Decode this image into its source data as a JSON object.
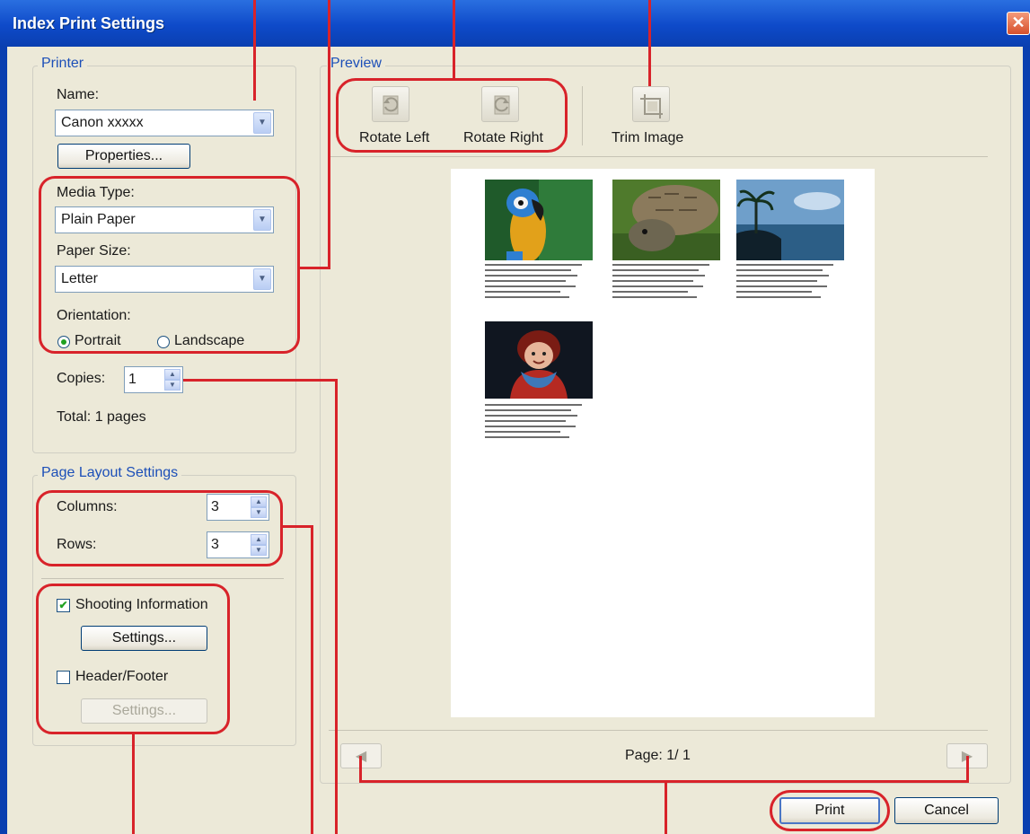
{
  "window": {
    "title": "Index Print Settings",
    "close_glyph": "✕"
  },
  "printer": {
    "legend": "Printer",
    "name_label": "Name:",
    "name_value": "Canon xxxxx",
    "properties_label": "Properties...",
    "media_type_label": "Media Type:",
    "media_type_value": "Plain Paper",
    "paper_size_label": "Paper Size:",
    "paper_size_value": "Letter",
    "orientation_label": "Orientation:",
    "portrait_label": "Portrait",
    "landscape_label": "Landscape",
    "orientation_selected": "Portrait",
    "copies_label": "Copies:",
    "copies_value": "1",
    "total_label": "Total: 1 pages"
  },
  "page_layout": {
    "legend": "Page Layout Settings",
    "columns_label": "Columns:",
    "columns_value": "3",
    "rows_label": "Rows:",
    "rows_value": "3",
    "shooting_info_label": "Shooting Information",
    "shooting_info_checked": true,
    "shooting_settings_label": "Settings...",
    "header_footer_label": "Header/Footer",
    "header_footer_checked": false,
    "header_settings_label": "Settings..."
  },
  "preview": {
    "legend": "Preview",
    "rotate_left_label": "Rotate Left",
    "rotate_right_label": "Rotate Right",
    "trim_image_label": "Trim Image",
    "page_indicator": "Page: 1/ 1",
    "thumbnails": [
      {
        "subject": "parrot"
      },
      {
        "subject": "tortoise"
      },
      {
        "subject": "seaside-palm"
      },
      {
        "subject": "child-in-winter-clothes"
      }
    ]
  },
  "footer": {
    "print_label": "Print",
    "cancel_label": "Cancel"
  },
  "icons": {
    "combo_arrow": "▼",
    "spin_up": "▲",
    "spin_down": "▼",
    "check": "✔",
    "prev": "◀",
    "next": "▶"
  },
  "colors": {
    "title_bar": "#0e4ac9",
    "dialog_bg": "#ece9d8",
    "annotation_red": "#d8232a",
    "legend_blue": "#1c4fb8"
  }
}
